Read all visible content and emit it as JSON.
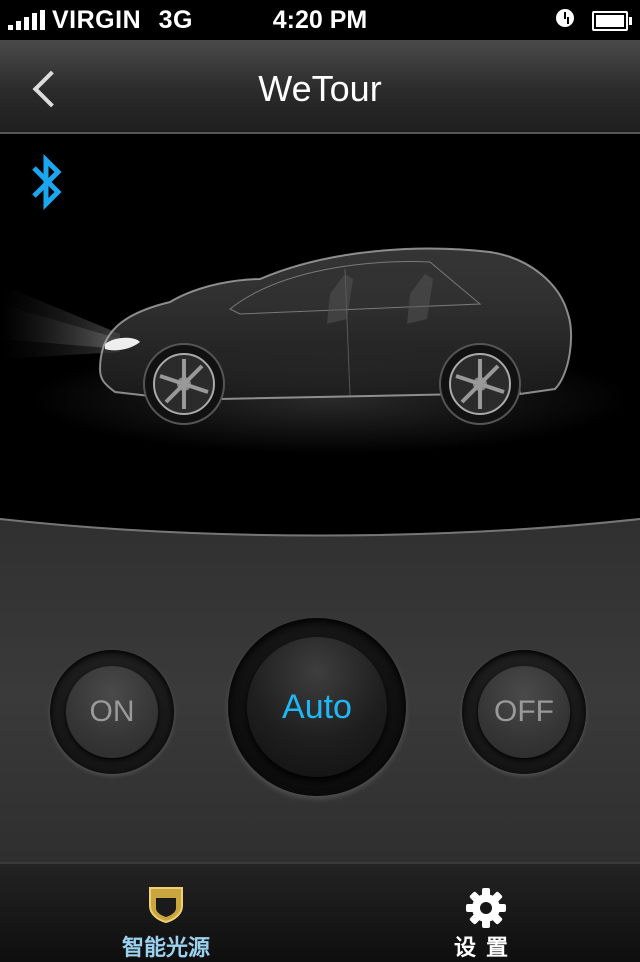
{
  "status_bar": {
    "carrier": "VIRGIN",
    "network": "3G",
    "time": "4:20 PM",
    "icons": [
      "signal-icon",
      "alarm-icon",
      "battery-icon"
    ]
  },
  "nav": {
    "title": "WeTour",
    "back_icon": "chevron-left-icon"
  },
  "stage": {
    "bluetooth_icon": "bluetooth-icon",
    "bluetooth_color": "#1aa7f0",
    "image": "car-illustration"
  },
  "controls": {
    "on_label": "ON",
    "auto_label": "Auto",
    "off_label": "OFF",
    "active_color": "#1fb8f5"
  },
  "tabs": [
    {
      "label": "智能光源",
      "icon": "shield-icon"
    },
    {
      "label": "设置",
      "icon": "gear-icon"
    }
  ]
}
